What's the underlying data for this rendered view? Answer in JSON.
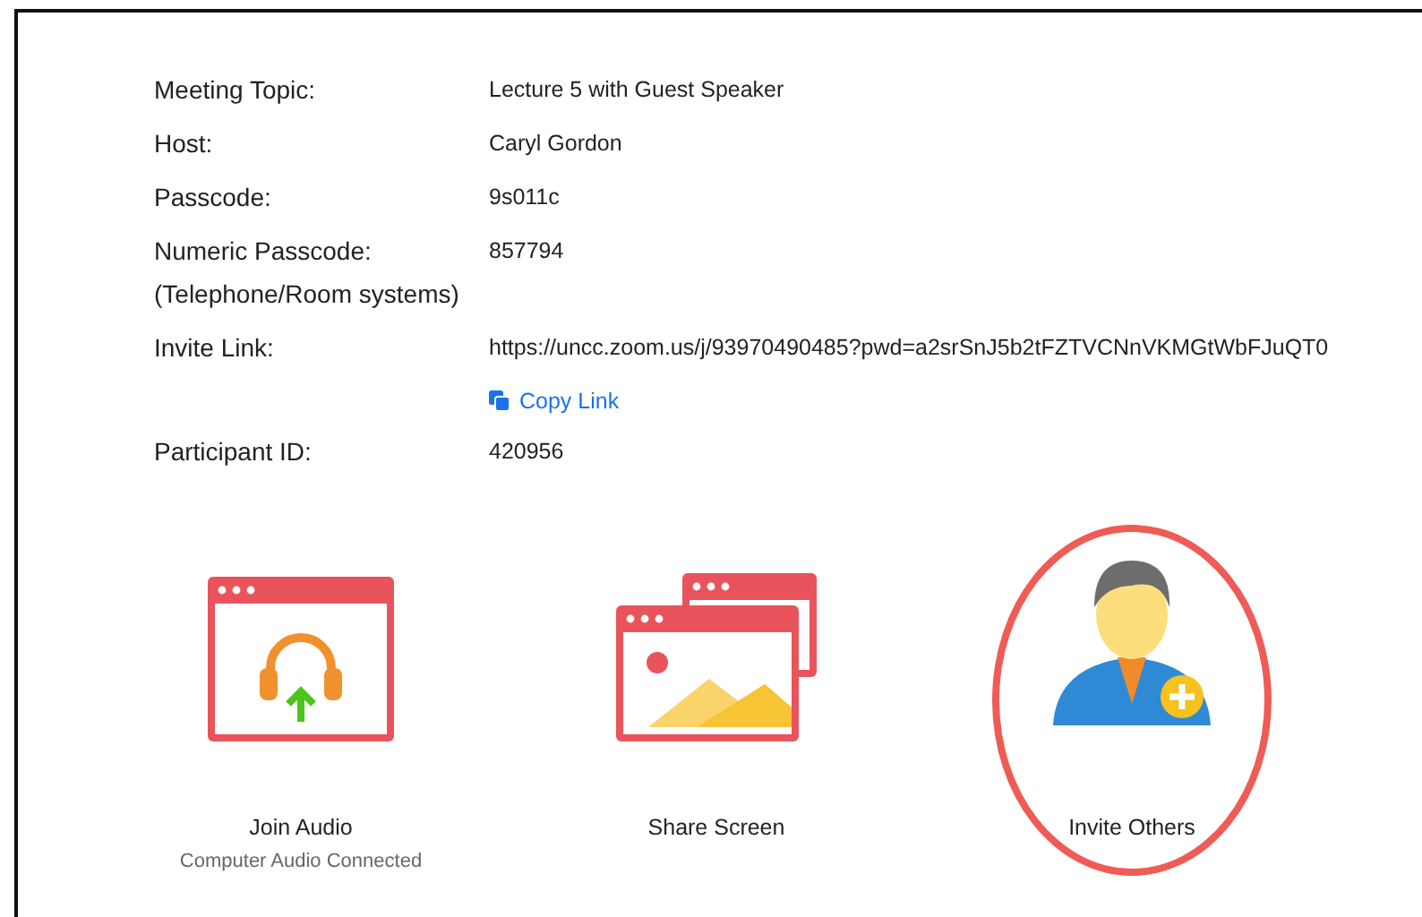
{
  "details": [
    {
      "label": "Meeting Topic:",
      "value": "Lecture 5 with Guest Speaker"
    },
    {
      "label": "Host:",
      "value": "Caryl Gordon"
    },
    {
      "label": "Passcode:",
      "value": "9s011c"
    },
    {
      "label": "Numeric Passcode:",
      "sublabel": "(Telephone/Room systems)",
      "value": "857794"
    },
    {
      "label": "Invite Link:",
      "value": "https://uncc.zoom.us/j/93970490485?pwd=a2srSnJ5b2tFZTVCNnVKMGtWbFJuQT0",
      "action": "Copy Link"
    },
    {
      "label": "Participant ID:",
      "value": "420956"
    }
  ],
  "actions": [
    {
      "kind": "audio",
      "label": "Join Audio",
      "status": "Computer Audio Connected",
      "highlighted": false
    },
    {
      "kind": "share",
      "label": "Share Screen",
      "highlighted": false
    },
    {
      "kind": "invite",
      "label": "Invite Others",
      "highlighted": true
    }
  ]
}
